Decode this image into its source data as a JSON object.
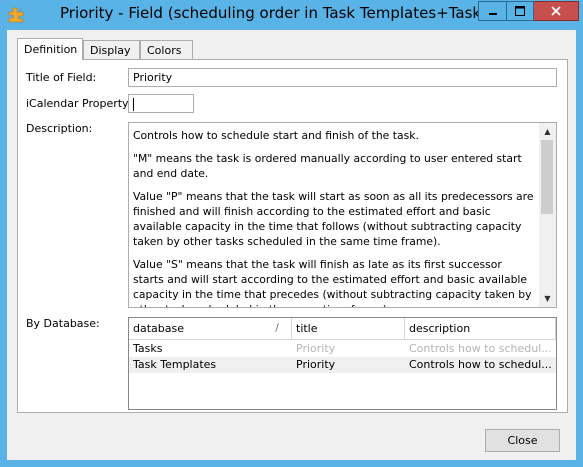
{
  "window": {
    "title": "Priority - Field (scheduling order in Task Templates+Tasks)",
    "app_icon": "puzzle-icon",
    "accent_color": "#59b3e6",
    "close_color": "#c7504f"
  },
  "tabs": [
    {
      "label": "Definition",
      "active": true
    },
    {
      "label": "Display",
      "active": false
    },
    {
      "label": "Colors",
      "active": false
    }
  ],
  "form": {
    "title_label": "Title of Field:",
    "title_value": "Priority",
    "ical_label": "iCalendar Property:",
    "ical_value": "",
    "description_label": "Description:",
    "description": {
      "p1": "Controls how to schedule start and finish of the task.",
      "p2": "\"M\" means the task is ordered manually according to user entered start and end date.",
      "p3": "Value \"P\" means that the task will start as soon as all its predecessors are finished and will finish according to the estimated effort and basic available capacity in the time that follows (without subtracting capacity taken by other tasks scheduled in the same time frame).",
      "p4": "Value \"S\" means that the task will finish as late as its first successor starts and will start according to the estimated effort and basic available capacity in the time that precedes (without subtracting capacity taken by other tasks scheduled in the same time frame)."
    },
    "by_database_label": "By Database:"
  },
  "grid": {
    "columns": [
      "database",
      "title",
      "description"
    ],
    "sort_indicator": "/",
    "rows": [
      {
        "database": "Tasks",
        "title": "Priority",
        "description": "Controls how to schedul...",
        "dim": true
      },
      {
        "database": "Task Templates",
        "title": "Priority",
        "description": "Controls how to schedul...",
        "dim": false
      }
    ]
  },
  "buttons": {
    "close": "Close"
  }
}
